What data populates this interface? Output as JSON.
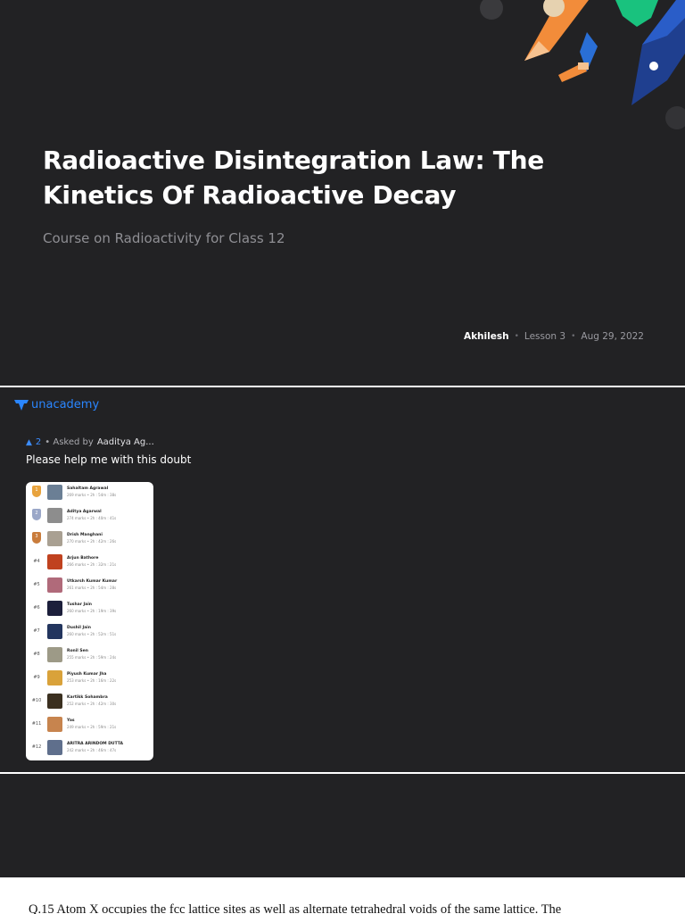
{
  "lesson": {
    "title": "Radioactive Disintegration Law: The Kinetics Of Radioactive Decay",
    "course": "Course on Radioactivity for Class 12",
    "author": "Akhilesh",
    "lesson_no": "Lesson 3",
    "date": "Aug 29, 2022"
  },
  "doubt": {
    "brand": "unacademy",
    "votes": "2",
    "asked_prefix": "• Asked by",
    "asker": "Aaditya Ag...",
    "question": "Please help me with this doubt"
  },
  "leaderboard": {
    "rows": [
      {
        "rank": "1",
        "name": "Sahaltam Agrawal",
        "stats": "269 marks • 2h : 54m : 38s",
        "medal": "#e8a33d",
        "avatar": "#6b7f95"
      },
      {
        "rank": "2",
        "name": "Aditya Agarwal",
        "stats": "274 marks • 2h : 40m : 41s",
        "medal": "#9aa7c8",
        "avatar": "#8d8d8d"
      },
      {
        "rank": "3",
        "name": "Drish Manghani",
        "stats": "270 marks • 2h : 42m : 26s",
        "medal": "#c97c3c",
        "avatar": "#a9a092"
      },
      {
        "rank": "#4",
        "name": "Arjun Bathore",
        "stats": "266 marks • 2h : 32m : 21s",
        "medal": "",
        "avatar": "#c0421f"
      },
      {
        "rank": "#5",
        "name": "Utkarsh Kumar Kumar",
        "stats": "261 marks • 2h : 54m : 28s",
        "medal": "",
        "avatar": "#b06a7a"
      },
      {
        "rank": "#6",
        "name": "Tushar Jain",
        "stats": "260 marks • 2h : 19m : 39s",
        "medal": "",
        "avatar": "#1c1f3b"
      },
      {
        "rank": "#7",
        "name": "Dushil Jain",
        "stats": "260 marks • 2h : 52m : 51s",
        "medal": "",
        "avatar": "#23355e"
      },
      {
        "rank": "#8",
        "name": "Ronil Sen",
        "stats": "255 marks • 2h : 59m : 24s",
        "medal": "",
        "avatar": "#9d9a87"
      },
      {
        "rank": "#9",
        "name": "Piyush Kumar Jha",
        "stats": "253 marks • 2h : 16m : 22s",
        "medal": "",
        "avatar": "#d9a23a"
      },
      {
        "rank": "#10",
        "name": "Kartikk Sohambra",
        "stats": "252 marks • 2h : 42m : 30s",
        "medal": "",
        "avatar": "#3b3020"
      },
      {
        "rank": "#11",
        "name": "Yas",
        "stats": "249 marks • 2h : 59m : 21s",
        "medal": "",
        "avatar": "#c7844e"
      },
      {
        "rank": "#12",
        "name": "ARITRA ARINDOM DUTTA",
        "stats": "242 marks • 2h : 46m : 47s",
        "medal": "",
        "avatar": "#5f6f8c"
      }
    ]
  },
  "document": {
    "text": "Q.15    Atom X occupies the fcc lattice sites as well as alternate tetrahedral voids of the same lattice.  The"
  },
  "colors": {
    "slide_bg": "#222224",
    "brand_blue": "#2a86ff",
    "accent_orange": "#f28c3a",
    "accent_green": "#19c27e",
    "accent_navy": "#1f3f8f"
  },
  "icons": [
    "pencil-icon",
    "pen-nib-icon",
    "bow-tie-icon",
    "unacademy-logo-icon",
    "upvote-arrow-icon"
  ]
}
